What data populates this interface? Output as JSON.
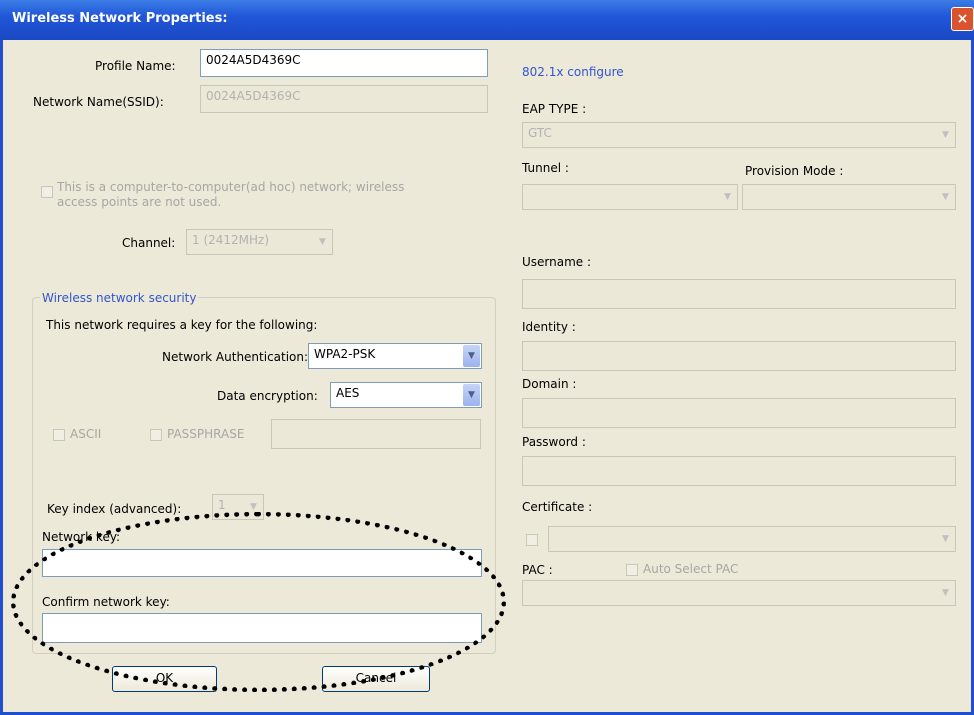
{
  "window": {
    "title": "Wireless Network Properties:",
    "close_symbol": "×"
  },
  "profile": {
    "label": "Profile Name:",
    "value": "0024A5D4369C"
  },
  "ssid": {
    "label": "Network Name(SSID):",
    "value": "0024A5D4369C"
  },
  "adhoc": {
    "label_line1": "This is a computer-to-computer(ad hoc) network; wireless",
    "label_line2": "access points are not used."
  },
  "channel": {
    "label": "Channel:",
    "value": "1 (2412MHz)"
  },
  "security": {
    "group_title": "Wireless network security",
    "requires_text": "This network requires a key for the following:",
    "auth_label": "Network Authentication:",
    "auth_value": "WPA2-PSK",
    "enc_label": "Data encryption:",
    "enc_value": "AES",
    "ascii_label": "ASCII",
    "passphrase_label": "PASSPHRASE",
    "key_index_label": "Key index (advanced):",
    "key_index_value": "1",
    "network_key_label": "Network key:",
    "confirm_key_label": "Confirm network key:"
  },
  "dot1x": {
    "title": "802.1x configure",
    "eap_label": "EAP TYPE :",
    "eap_value": "GTC",
    "tunnel_label": "Tunnel :",
    "provision_label": "Provision Mode :",
    "username_label": "Username :",
    "identity_label": "Identity :",
    "domain_label": "Domain :",
    "password_label": "Password :",
    "certificate_label": "Certificate :",
    "pac_label": "PAC :",
    "auto_pac_label": "Auto Select PAC"
  },
  "buttons": {
    "ok": "OK",
    "cancel": "Cancel"
  },
  "colors": {
    "titlebar": "#2157d8",
    "dialog_bg": "#ece9d8",
    "group_title": "#3355cc",
    "highlight_oval": "#000000"
  },
  "icons": {
    "dropdown": "chevron-down-icon",
    "close": "close-icon"
  }
}
